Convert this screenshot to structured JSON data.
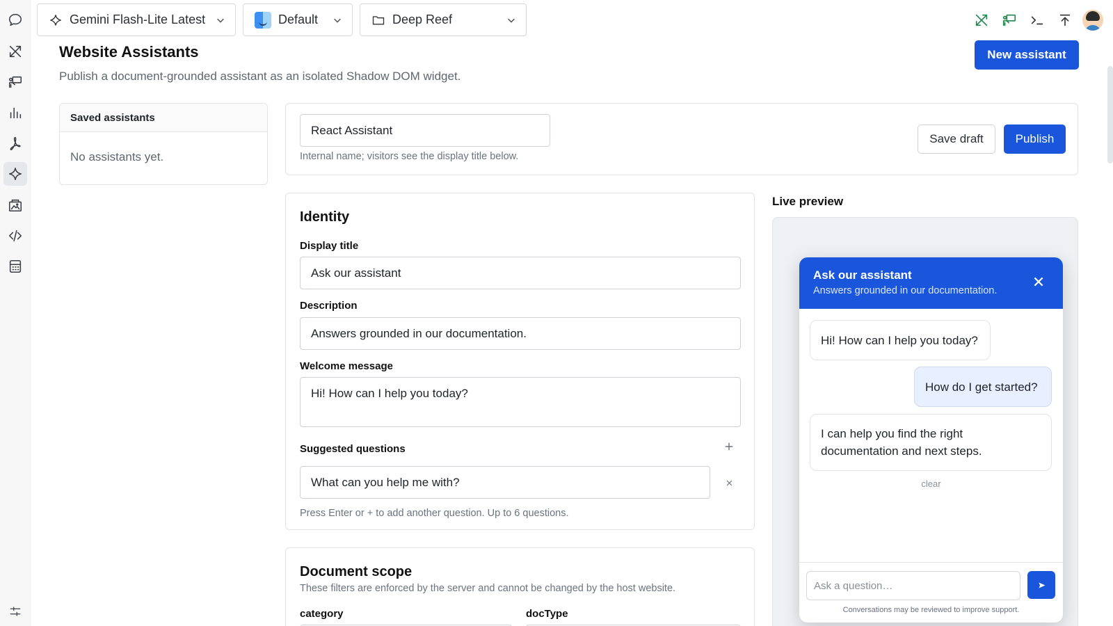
{
  "topbar": {
    "model_selector": "Gemini Flash-Lite Latest",
    "profile_selector": "Default",
    "folder_selector": "Deep Reef"
  },
  "page": {
    "title": "Website Assistants",
    "subtitle": "Publish a document-grounded assistant as an isolated Shadow DOM widget.",
    "new_button": "New assistant"
  },
  "saved_assistants": {
    "header": "Saved assistants",
    "empty_text": "No assistants yet."
  },
  "editor": {
    "name_value": "React Assistant",
    "name_hint": "Internal name; visitors see the display title below.",
    "save_draft": "Save draft",
    "publish": "Publish"
  },
  "identity": {
    "title": "Identity",
    "display_title_label": "Display title",
    "display_title_value": "Ask our assistant",
    "description_label": "Description",
    "description_value": "Answers grounded in our documentation.",
    "welcome_label": "Welcome message",
    "welcome_value": "Hi! How can I help you today?",
    "suggested_label": "Suggested questions",
    "suggested_items": [
      "What can you help me with?"
    ],
    "suggested_hint": "Press Enter or + to add another question. Up to 6 questions."
  },
  "scope": {
    "title": "Document scope",
    "hint": "These filters are enforced by the server and cannot be changed by the host website.",
    "field1_label": "category",
    "field2_label": "docType"
  },
  "preview": {
    "title": "Live preview",
    "widget_title": "Ask our assistant",
    "widget_desc": "Answers grounded in our documentation.",
    "messages": [
      {
        "role": "assistant",
        "text": "Hi! How can I help you today?"
      },
      {
        "role": "user",
        "text": "How do I get started?"
      },
      {
        "role": "assistant",
        "text": "I can help you find the right documentation and next steps."
      }
    ],
    "clear_label": "clear",
    "input_placeholder": "Ask a question…",
    "footer_note": "Conversations may be reviewed to improve support."
  },
  "sidebar_icons": [
    "chat-icon",
    "tools-icon",
    "presentation-icon",
    "chart-icon",
    "pdf-icon",
    "sparkle-icon",
    "image-gallery-icon",
    "code-icon",
    "calculator-icon",
    "settings-sliders-icon"
  ],
  "colors": {
    "accent": "#1a56db",
    "green_icon": "#1f8a4c"
  }
}
